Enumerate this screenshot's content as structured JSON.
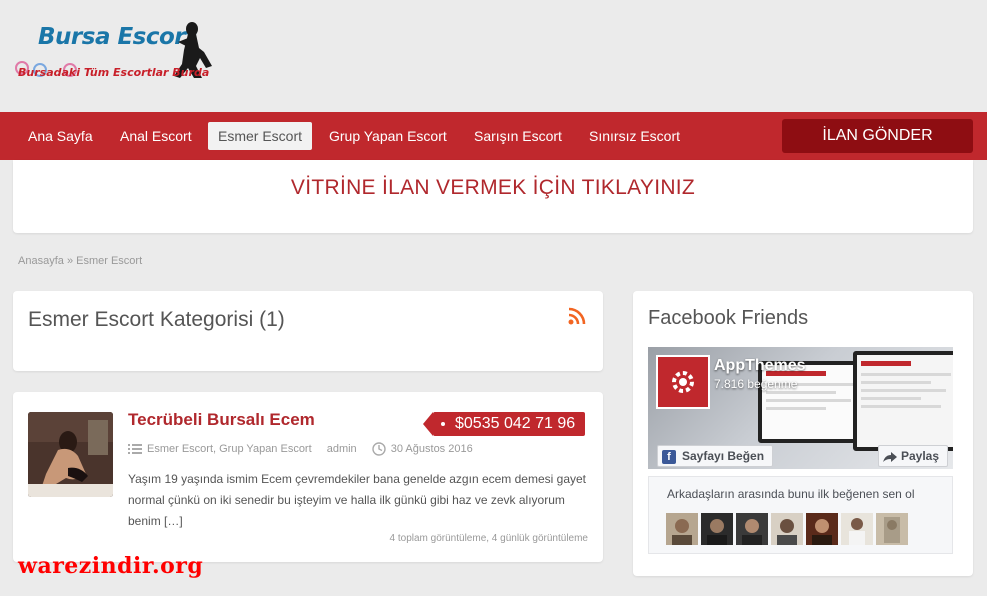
{
  "header": {
    "logo_line1": "Bursa Escort",
    "logo_line2": "Bursadaki Tüm Escortlar Burda"
  },
  "nav": {
    "items": [
      {
        "label": "Ana Sayfa",
        "active": false
      },
      {
        "label": "Anal Escort",
        "active": false
      },
      {
        "label": "Esmer Escort",
        "active": true
      },
      {
        "label": "Grup Yapan Escort",
        "active": false
      },
      {
        "label": "Sarışın Escort",
        "active": false
      },
      {
        "label": "Sınırsız Escort",
        "active": false
      }
    ],
    "cta_label": "İLAN GÖNDER"
  },
  "banner": {
    "text": "VİTRİNE İLAN VERMEK İÇİN TIKLAYINIZ"
  },
  "breadcrumb": {
    "home": "Anasayfa",
    "separator": "»",
    "current": "Esmer Escort"
  },
  "category": {
    "title": "Esmer Escort Kategorisi (1)",
    "rss_icon": "rss-icon"
  },
  "post": {
    "title": "Tecrübeli Bursalı Ecem",
    "price": "$0535 042 71 96",
    "categories": "Esmer Escort, Grup Yapan Escort",
    "author": "admin",
    "date": "30 Ağustos 2016",
    "excerpt": "Yaşım 19 yaşında ismim Ecem çevremdekiler bana genelde azgın ecem demesi gayet normal çünkü on iki senedir bu işteyim ve halla ilk günkü gibi haz ve zevk alıyorum benim […]",
    "views": "4 toplam görüntüleme, 4 günlük görüntüleme"
  },
  "facebook": {
    "title": "Facebook Friends",
    "page_name": "AppThemes",
    "likes": "7.816 beğenme",
    "like_button": "Sayfayı Beğen",
    "share_button": "Paylaş",
    "friends_text": "Arkadaşların arasında bunu ilk beğenen sen ol",
    "avatar_count": 7
  },
  "watermark": "warezindir.org",
  "colors": {
    "brand_red": "#c0282d",
    "cta_dark_red": "#8e0d12",
    "logo_blue": "#1a76a8",
    "facebook_blue": "#3b5998"
  }
}
